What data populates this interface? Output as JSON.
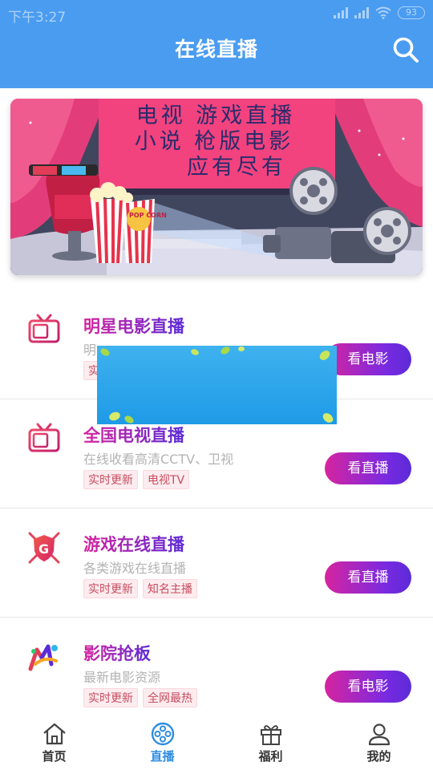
{
  "statusbar": {
    "time": "下午3:27",
    "battery": "93"
  },
  "header": {
    "title": "在线直播"
  },
  "banner": {
    "lines": [
      "电视 游戏直播",
      "小说 枪版电影",
      "应有尽有"
    ],
    "popcorn": "POP CORN"
  },
  "items": [
    {
      "name": "明星电影直播",
      "desc": "明",
      "tags": [
        "实"
      ],
      "button": "看电影",
      "icon": "tv-icon"
    },
    {
      "name": "全国电视直播",
      "desc": "在线收看高清CCTV、卫视",
      "tags": [
        "实时更新",
        "电视TV"
      ],
      "button": "看直播",
      "icon": "tv-icon"
    },
    {
      "name": "游戏在线直播",
      "desc": "各类游戏在线直播",
      "tags": [
        "实时更新",
        "知名主播"
      ],
      "button": "看直播",
      "icon": "game-shield-icon"
    },
    {
      "name": "影院抢板",
      "desc": "最新电影资源",
      "tags": [
        "实时更新",
        "全网最热"
      ],
      "button": "看电影",
      "icon": "colorful-logo-icon"
    }
  ],
  "nav": [
    {
      "label": "首页",
      "icon": "home-icon"
    },
    {
      "label": "直播",
      "icon": "film-reel-icon"
    },
    {
      "label": "福利",
      "icon": "gift-icon"
    },
    {
      "label": "我的",
      "icon": "user-icon"
    }
  ],
  "colors": {
    "header": "#4a9cf0",
    "accent": "#2f8de0",
    "button_start": "#d6249f",
    "button_end": "#5b2bd8"
  }
}
